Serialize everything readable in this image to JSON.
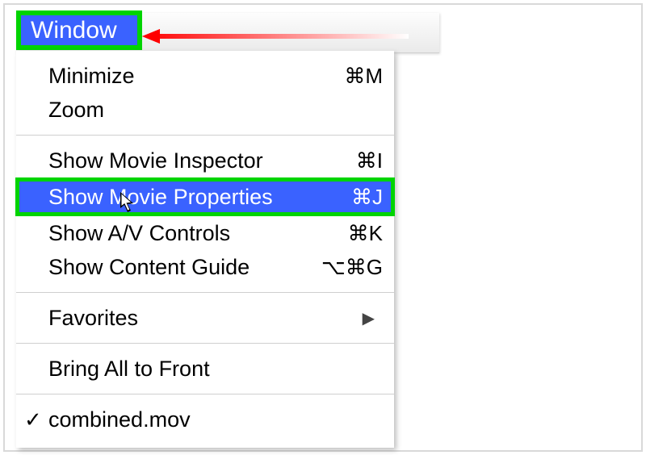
{
  "menubar": {
    "title": "Window"
  },
  "menu": {
    "minimize": {
      "label": "Minimize",
      "shortcut": "⌘M"
    },
    "zoom": {
      "label": "Zoom",
      "shortcut": ""
    },
    "show_inspector": {
      "label": "Show Movie Inspector",
      "shortcut": "⌘I"
    },
    "show_properties": {
      "label": "Show Movie Properties",
      "shortcut": "⌘J"
    },
    "show_av": {
      "label": "Show A/V Controls",
      "shortcut": "⌘K"
    },
    "show_guide": {
      "label": "Show Content Guide",
      "shortcut": "⌥⌘G"
    },
    "favorites": {
      "label": "Favorites",
      "shortcut": ""
    },
    "bring_front": {
      "label": "Bring All to Front",
      "shortcut": ""
    },
    "doc": {
      "label": "combined.mov",
      "shortcut": ""
    }
  },
  "annotation": {
    "highlight_color": "#00d400",
    "selection_color": "#3a62ff",
    "arrow_color": "#ff0000"
  }
}
